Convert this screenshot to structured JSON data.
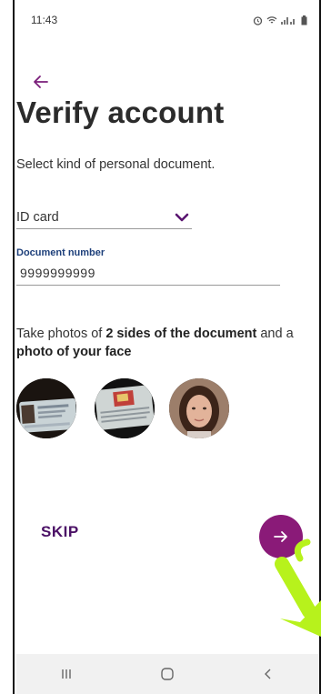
{
  "status_bar": {
    "time": "11:43"
  },
  "header": {
    "title": "Verify account",
    "subtitle": "Select kind of personal document."
  },
  "document_type": {
    "selected": "ID card"
  },
  "document_number": {
    "label": "Document number",
    "value": "9999999999"
  },
  "photos": {
    "text_prefix": "Take photos of ",
    "text_bold_1": "2 sides of the document",
    "text_middle": " and a ",
    "text_bold_2": "photo of your face"
  },
  "actions": {
    "skip_label": "SKIP"
  },
  "colors": {
    "accent": "#8a1a78",
    "skip": "#4b1166",
    "label": "#1d3f7a",
    "highlight": "#b7f21c"
  },
  "icons": [
    "back-arrow-icon",
    "chevron-down-icon",
    "arrow-right-icon",
    "recent-apps-icon",
    "home-icon",
    "back-nav-icon"
  ]
}
